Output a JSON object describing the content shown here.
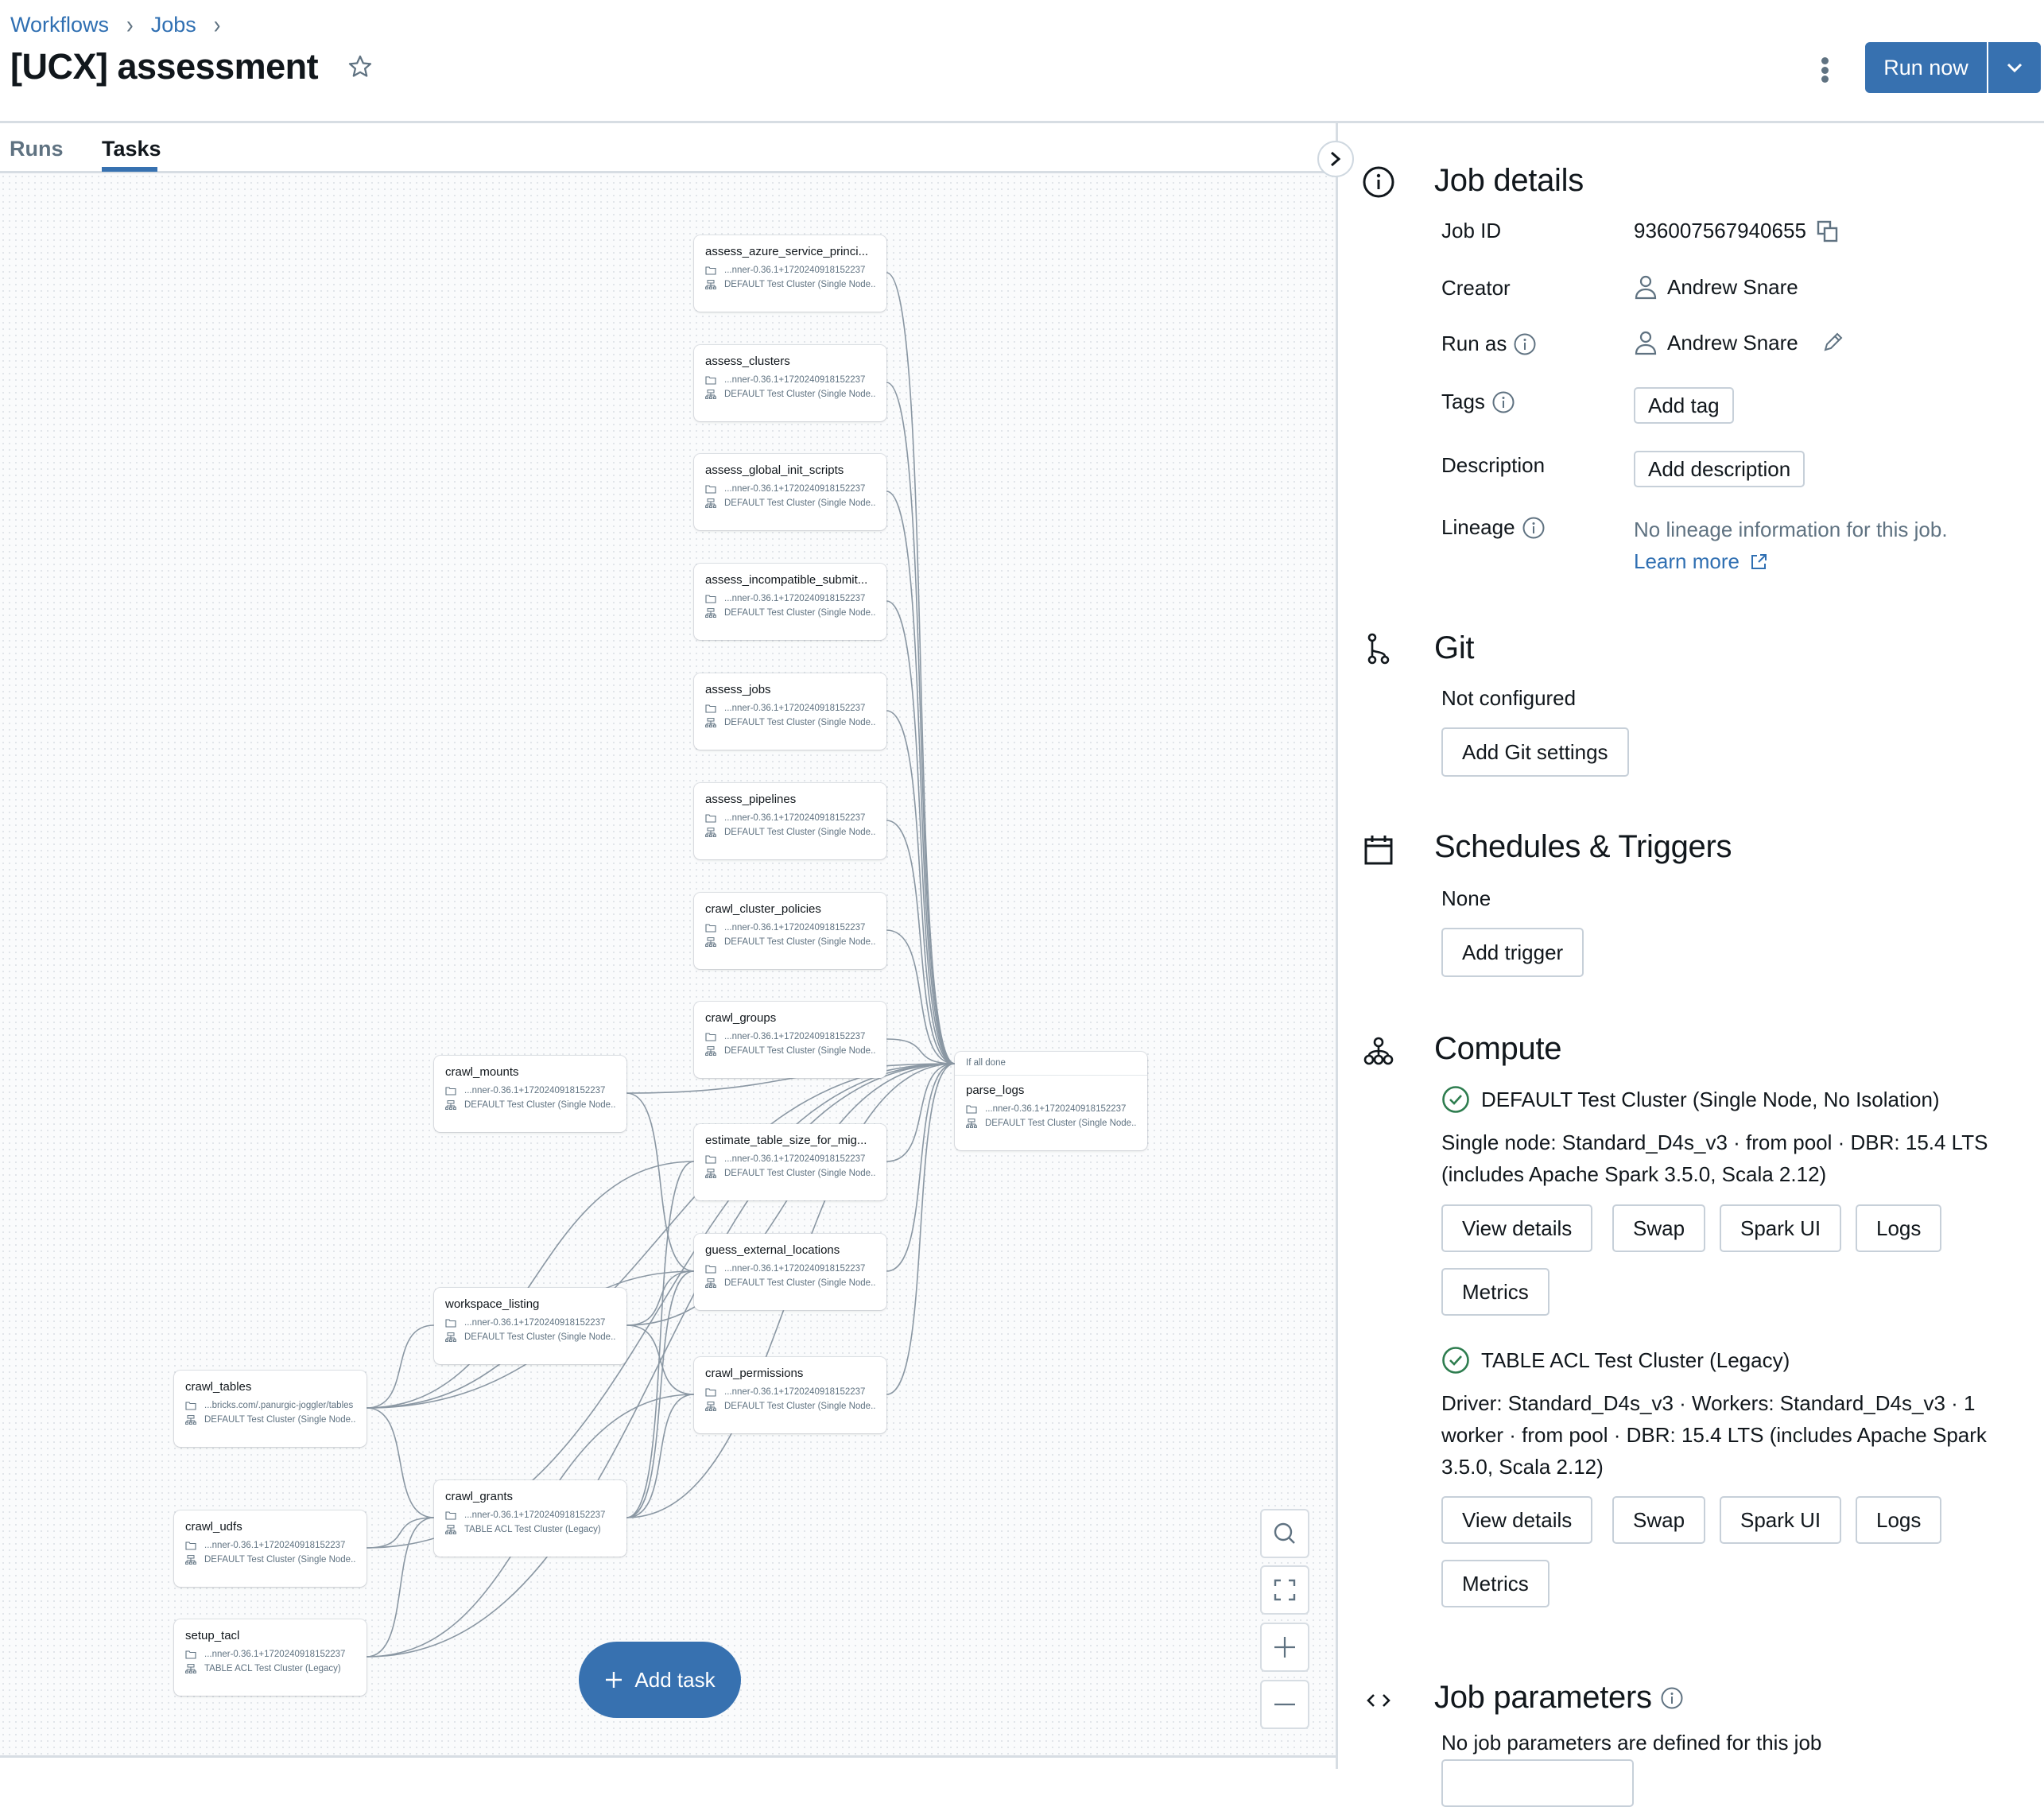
{
  "breadcrumb": [
    {
      "label": "Workflows"
    },
    {
      "label": "Jobs"
    }
  ],
  "header": {
    "title": "[UCX] assessment",
    "run_now_label": "Run now"
  },
  "tabs": [
    {
      "label": "Runs",
      "active": false
    },
    {
      "label": "Tasks",
      "active": true
    }
  ],
  "colors": {
    "accent": "#3771b0",
    "link": "#2f6fb2",
    "success": "#2e7d4f",
    "muted": "#5f7281",
    "edge": "#8a97a3"
  },
  "canvas": {
    "add_task_label": "Add task",
    "controls": [
      {
        "name": "search-icon"
      },
      {
        "name": "fit-view-icon"
      },
      {
        "name": "zoom-in-icon"
      },
      {
        "name": "zoom-out-icon"
      }
    ],
    "nodes": [
      {
        "id": "n1",
        "name": "assess_azure_service_princi...",
        "path": "...nner-0.36.1+1720240918152237",
        "cluster": "DEFAULT Test Cluster (Single Node..."
      },
      {
        "id": "n2",
        "name": "assess_clusters",
        "path": "...nner-0.36.1+1720240918152237",
        "cluster": "DEFAULT Test Cluster (Single Node..."
      },
      {
        "id": "n3",
        "name": "assess_global_init_scripts",
        "path": "...nner-0.36.1+1720240918152237",
        "cluster": "DEFAULT Test Cluster (Single Node..."
      },
      {
        "id": "n4",
        "name": "assess_incompatible_submit...",
        "path": "...nner-0.36.1+1720240918152237",
        "cluster": "DEFAULT Test Cluster (Single Node..."
      },
      {
        "id": "n5",
        "name": "assess_jobs",
        "path": "...nner-0.36.1+1720240918152237",
        "cluster": "DEFAULT Test Cluster (Single Node..."
      },
      {
        "id": "n6",
        "name": "assess_pipelines",
        "path": "...nner-0.36.1+1720240918152237",
        "cluster": "DEFAULT Test Cluster (Single Node..."
      },
      {
        "id": "n7",
        "name": "crawl_cluster_policies",
        "path": "...nner-0.36.1+1720240918152237",
        "cluster": "DEFAULT Test Cluster (Single Node..."
      },
      {
        "id": "n8",
        "name": "crawl_groups",
        "path": "...nner-0.36.1+1720240918152237",
        "cluster": "DEFAULT Test Cluster (Single Node..."
      },
      {
        "id": "n9",
        "name": "estimate_table_size_for_mig...",
        "path": "...nner-0.36.1+1720240918152237",
        "cluster": "DEFAULT Test Cluster (Single Node..."
      },
      {
        "id": "n10",
        "name": "guess_external_locations",
        "path": "...nner-0.36.1+1720240918152237",
        "cluster": "DEFAULT Test Cluster (Single Node..."
      },
      {
        "id": "n11",
        "name": "crawl_permissions",
        "path": "...nner-0.36.1+1720240918152237",
        "cluster": "DEFAULT Test Cluster (Single Node..."
      },
      {
        "id": "n12",
        "name": "crawl_mounts",
        "path": "...nner-0.36.1+1720240918152237",
        "cluster": "DEFAULT Test Cluster (Single Node..."
      },
      {
        "id": "n13",
        "name": "workspace_listing",
        "path": "...nner-0.36.1+1720240918152237",
        "cluster": "DEFAULT Test Cluster (Single Node..."
      },
      {
        "id": "n14",
        "name": "crawl_grants",
        "path": "...nner-0.36.1+1720240918152237",
        "cluster": "TABLE ACL Test Cluster (Legacy)"
      },
      {
        "id": "n15",
        "name": "crawl_tables",
        "path": "...bricks.com/.panurgic-joggler/tables",
        "cluster": "DEFAULT Test Cluster (Single Node..."
      },
      {
        "id": "n16",
        "name": "crawl_udfs",
        "path": "...nner-0.36.1+1720240918152237",
        "cluster": "DEFAULT Test Cluster (Single Node..."
      },
      {
        "id": "n17",
        "name": "setup_tacl",
        "path": "...nner-0.36.1+1720240918152237",
        "cluster": "TABLE ACL Test Cluster (Legacy)"
      },
      {
        "id": "n18",
        "name": "parse_logs",
        "condition": "If all done",
        "path": "...nner-0.36.1+1720240918152237",
        "cluster": "DEFAULT Test Cluster (Single Node..."
      }
    ],
    "edges": [
      [
        "n1",
        "n18"
      ],
      [
        "n2",
        "n18"
      ],
      [
        "n3",
        "n18"
      ],
      [
        "n4",
        "n18"
      ],
      [
        "n5",
        "n18"
      ],
      [
        "n6",
        "n18"
      ],
      [
        "n7",
        "n18"
      ],
      [
        "n8",
        "n18"
      ],
      [
        "n9",
        "n18"
      ],
      [
        "n10",
        "n18"
      ],
      [
        "n11",
        "n18"
      ],
      [
        "n12",
        "n18"
      ],
      [
        "n13",
        "n18"
      ],
      [
        "n14",
        "n18"
      ],
      [
        "n15",
        "n18"
      ],
      [
        "n16",
        "n18"
      ],
      [
        "n17",
        "n18"
      ],
      [
        "n15",
        "n13"
      ],
      [
        "n15",
        "n9"
      ],
      [
        "n15",
        "n10"
      ],
      [
        "n15",
        "n14"
      ],
      [
        "n12",
        "n10"
      ],
      [
        "n13",
        "n10"
      ],
      [
        "n13",
        "n11"
      ],
      [
        "n16",
        "n14"
      ],
      [
        "n17",
        "n14"
      ],
      [
        "n14",
        "n11"
      ],
      [
        "n14",
        "n9"
      ],
      [
        "n14",
        "n10"
      ],
      [
        "n17",
        "n11"
      ]
    ]
  },
  "panel": {
    "job_details": {
      "title": "Job details",
      "job_id_label": "Job ID",
      "job_id": "936007567940655",
      "creator_label": "Creator",
      "creator": "Andrew Snare",
      "run_as_label": "Run as",
      "run_as": "Andrew Snare",
      "tags_label": "Tags",
      "add_tag": "Add tag",
      "description_label": "Description",
      "add_description": "Add description",
      "lineage_label": "Lineage",
      "lineage_text": "No lineage information for this job.",
      "learn_more": "Learn more"
    },
    "git": {
      "title": "Git",
      "status": "Not configured",
      "button": "Add Git settings"
    },
    "schedules": {
      "title": "Schedules & Triggers",
      "status": "None",
      "button": "Add trigger"
    },
    "compute": {
      "title": "Compute",
      "clusters": [
        {
          "name": "DEFAULT Test Cluster (Single Node, No Isolation)",
          "status": "running",
          "details": "Single node: Standard_D4s_v3 · from pool · DBR: 15.4 LTS (includes Apache Spark 3.5.0, Scala 2.12)",
          "buttons": [
            "View details",
            "Swap",
            "Spark UI",
            "Logs",
            "Metrics"
          ]
        },
        {
          "name": "TABLE ACL Test Cluster (Legacy)",
          "status": "running",
          "details": "Driver: Standard_D4s_v3 · Workers: Standard_D4s_v3 · 1 worker · from pool · DBR: 15.4 LTS (includes Apache Spark 3.5.0, Scala 2.12)",
          "buttons": [
            "View details",
            "Swap",
            "Spark UI",
            "Logs",
            "Metrics"
          ]
        }
      ]
    },
    "job_parameters": {
      "title": "Job parameters",
      "status": "No job parameters are defined for this job"
    }
  }
}
